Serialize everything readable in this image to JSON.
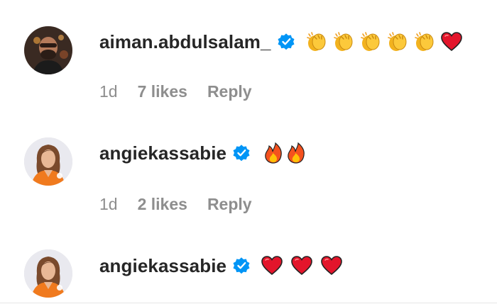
{
  "comments": [
    {
      "username": "aiman.abdulsalam_",
      "verified": true,
      "emojis": [
        "clapping-hands",
        "clapping-hands",
        "clapping-hands",
        "clapping-hands",
        "clapping-hands",
        "red-heart"
      ],
      "time": "1d",
      "likes": "7 likes",
      "reply": "Reply"
    },
    {
      "username": "angiekassabie",
      "verified": true,
      "emojis": [
        "fire",
        "fire"
      ],
      "time": "1d",
      "likes": "2 likes",
      "reply": "Reply"
    },
    {
      "username": "angiekassabie",
      "verified": true,
      "emojis": [
        "red-heart",
        "red-heart",
        "red-heart"
      ]
    }
  ],
  "colors": {
    "verified_blue": "#0095f6",
    "meta_gray": "#8e8e8e",
    "text": "#262626"
  }
}
